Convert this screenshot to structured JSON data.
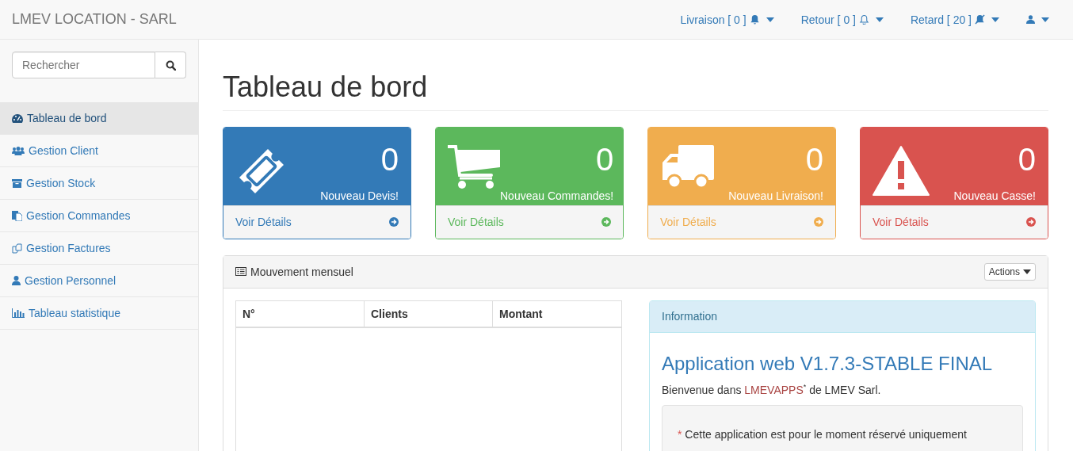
{
  "navbar": {
    "brand": "LMEV LOCATION - SARL",
    "menus": [
      {
        "label": "Livraison [ 0 ]",
        "kind": "bell"
      },
      {
        "label": "Retour [ 0 ]",
        "kind": "bell-outline"
      },
      {
        "label": "Retard [ 20 ]",
        "kind": "bell-slash"
      },
      {
        "kind": "user"
      }
    ]
  },
  "sidebar": {
    "search": {
      "placeholder": "Rechercher"
    },
    "items": [
      {
        "label": "Tableau de bord",
        "kind": "dashboard",
        "selected": true
      },
      {
        "label": "Gestion Client",
        "kind": "users",
        "selected": false
      },
      {
        "label": "Gestion Stock",
        "kind": "archive",
        "selected": false
      },
      {
        "label": "Gestion Commandes",
        "kind": "files",
        "selected": false
      },
      {
        "label": "Gestion Factures",
        "kind": "copy",
        "selected": false
      },
      {
        "label": "Gestion Personnel",
        "kind": "user",
        "selected": false
      },
      {
        "label": "Tableau statistique",
        "kind": "chart",
        "selected": false
      }
    ]
  },
  "page": {
    "title": "Tableau de bord"
  },
  "cards": [
    {
      "kind": "ticket",
      "color": "#337ab7",
      "count": "0",
      "label": "Nouveau Devis!",
      "link": "Voir Détails"
    },
    {
      "kind": "cart",
      "color": "#5cb85c",
      "count": "0",
      "label": "Nouveau Commandes!",
      "link": "Voir Détails"
    },
    {
      "kind": "truck",
      "color": "#f0ad4e",
      "count": "0",
      "label": "Nouveau Livraison!",
      "link": "Voir Détails"
    },
    {
      "kind": "warning",
      "color": "#d9534f",
      "count": "0",
      "label": "Nouveau Casse!",
      "link": "Voir Détails"
    }
  ],
  "panel": {
    "title": "Mouvement mensuel",
    "actions": "Actions",
    "table": {
      "columns": [
        "N°",
        "Clients",
        "Montant"
      ]
    },
    "info": {
      "heading": "Information",
      "title": "Application web V1.7.3-STABLE FINAL",
      "welcome_before": "Bienvenue dans ",
      "welcome_link": "LMEVAPPS",
      "welcome_mark": "*",
      "welcome_after": " de LMEV Sarl.",
      "note_mark": "*",
      "note": "Cette application est pour le moment réservé uniquement"
    }
  }
}
